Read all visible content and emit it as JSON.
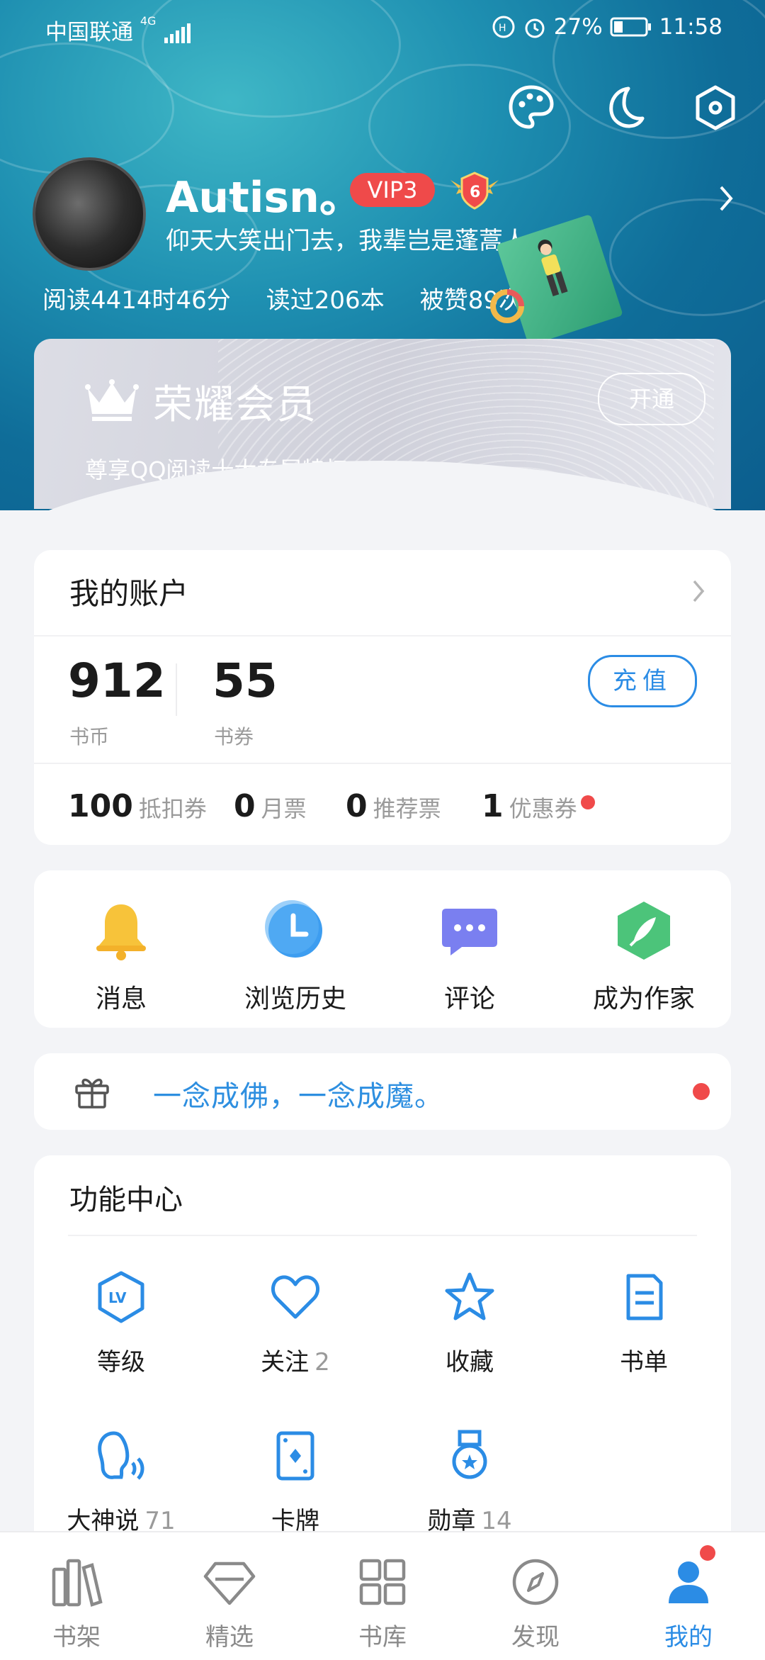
{
  "status_bar": {
    "carrier": "中国联通",
    "network": "4G",
    "battery": "27%",
    "time": "11:58"
  },
  "header": {
    "username": "Autisn。",
    "vip_level": "VIP3",
    "rank_badge": "6",
    "signature": "仰天大笑出门去，我辈岂是蓬蒿人",
    "stats": {
      "reading_time": "阅读4414时46分",
      "books_read": "读过206本",
      "likes": "被赞89次"
    },
    "icons": [
      "palette-icon",
      "moon-icon",
      "settings-hexagon-icon"
    ]
  },
  "vip_card": {
    "title": "荣耀会员",
    "subtitle": "尊享QQ阅读十大专属特权",
    "open_label": "开通"
  },
  "account": {
    "title": "我的账户",
    "coins_value": "912",
    "coins_label": "书币",
    "vouchers_value": "55",
    "vouchers_label": "书券",
    "recharge_label": "充值",
    "tickets": [
      {
        "value": "100",
        "label": "抵扣券"
      },
      {
        "value": "0",
        "label": "月票"
      },
      {
        "value": "0",
        "label": "推荐票"
      },
      {
        "value": "1",
        "label": "优惠券"
      }
    ]
  },
  "shortcuts": [
    {
      "label": "消息",
      "icon": "bell-icon"
    },
    {
      "label": "浏览历史",
      "icon": "clock-icon"
    },
    {
      "label": "评论",
      "icon": "comment-icon"
    },
    {
      "label": "成为作家",
      "icon": "feather-icon"
    }
  ],
  "promo": {
    "text": "一念成佛，一念成魔。"
  },
  "function_center": {
    "title": "功能中心",
    "items": [
      {
        "label": "等级",
        "count": "",
        "icon": "level-icon"
      },
      {
        "label": "关注",
        "count": "2",
        "icon": "heart-icon"
      },
      {
        "label": "收藏",
        "count": "",
        "icon": "star-icon"
      },
      {
        "label": "书单",
        "count": "",
        "icon": "booklist-icon"
      },
      {
        "label": "大神说",
        "count": "71",
        "icon": "speaker-icon"
      },
      {
        "label": "卡牌",
        "count": "",
        "icon": "card-icon"
      },
      {
        "label": "勋章",
        "count": "14",
        "icon": "medal-icon"
      }
    ]
  },
  "bottom_nav": [
    {
      "label": "书架",
      "icon": "bookshelf-icon"
    },
    {
      "label": "精选",
      "icon": "diamond-icon"
    },
    {
      "label": "书库",
      "icon": "grid-icon"
    },
    {
      "label": "发现",
      "icon": "compass-icon"
    },
    {
      "label": "我的",
      "icon": "user-icon",
      "active": true
    }
  ],
  "colors": {
    "accent": "#2b8ce5",
    "vip_red": "#ef4a4a",
    "header_teal": "#1e8fb1"
  }
}
